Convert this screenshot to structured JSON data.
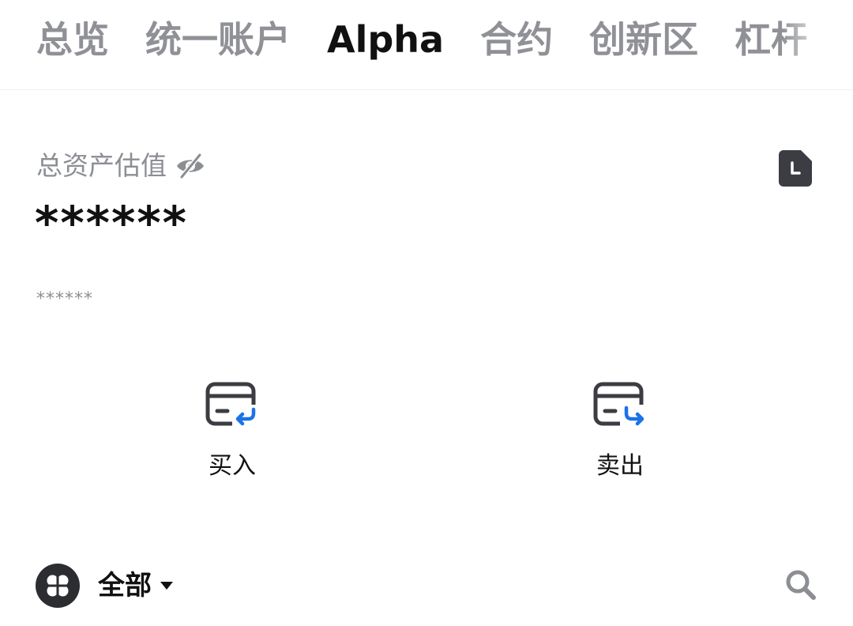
{
  "tabs": [
    {
      "label": "总览",
      "active": false
    },
    {
      "label": "统一账户",
      "active": false
    },
    {
      "label": "Alpha",
      "active": true
    },
    {
      "label": "合约",
      "active": false
    },
    {
      "label": "创新区",
      "active": false
    },
    {
      "label": "杠杆",
      "active": false
    }
  ],
  "assets": {
    "label": "总资产估值",
    "total_value": "******",
    "sub_value": "******",
    "icons": {
      "visibility": "eye-slash-icon",
      "history": "history-document-icon"
    }
  },
  "actions": {
    "buy_label": "买入",
    "sell_label": "卖出",
    "icons": {
      "buy": "card-receive-icon",
      "sell": "card-send-icon"
    }
  },
  "filter": {
    "label": "全部",
    "icons": {
      "avatar": "grid-clover-icon",
      "dropdown": "caret-down-icon",
      "search": "search-icon"
    }
  },
  "colors": {
    "accent": "#1a73e8",
    "text_primary": "#111111",
    "text_muted": "#8b8e93",
    "icon_dark": "#3c3d42"
  }
}
